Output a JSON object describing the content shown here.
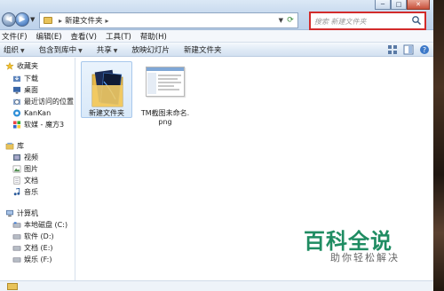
{
  "window": {
    "minimize": "─",
    "maximize": "□",
    "close": "✕"
  },
  "address": {
    "path": [
      "新建文件夹"
    ]
  },
  "search": {
    "placeholder": "搜索 新建文件夹"
  },
  "menu": [
    "文件(F)",
    "编辑(E)",
    "查看(V)",
    "工具(T)",
    "帮助(H)"
  ],
  "toolbar": [
    "组织",
    "包含到库中",
    "共享",
    "放映幻灯片",
    "新建文件夹"
  ],
  "nav": {
    "favorites": {
      "label": "收藏夹",
      "items": [
        "下载",
        "桌面",
        "最近访问的位置",
        "KanKan",
        "软媒 - 魔方3"
      ]
    },
    "library": {
      "label": "库",
      "items": [
        "视频",
        "图片",
        "文档",
        "音乐"
      ]
    },
    "computer": {
      "label": "计算机",
      "items": [
        "本地磁盘 (C:)",
        "软件 (D:)",
        "文档 (E:)",
        "娱乐 (F:)"
      ]
    }
  },
  "files": [
    {
      "name": "新建文件夹",
      "type": "folder",
      "selected": true
    },
    {
      "name": "TM截图未命名.png",
      "line1": "TM截图未命名.",
      "line2": "png",
      "type": "png",
      "selected": false
    }
  ],
  "watermark": {
    "logo": "百科全说",
    "sub": "助你轻松解决"
  },
  "colors": {
    "highlight": "#d22b2b",
    "brand": "#1f8c62"
  },
  "icons": [
    "back-icon",
    "forward-icon",
    "refresh-icon",
    "search-icon",
    "star-icon",
    "folder-icon"
  ]
}
